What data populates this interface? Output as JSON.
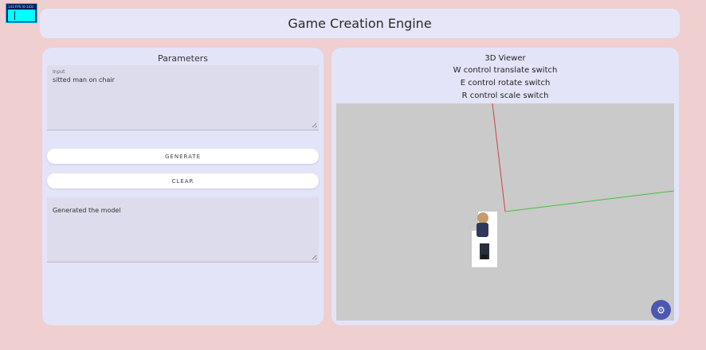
{
  "fps_overlay": {
    "label": "143 FPS (0-143)"
  },
  "header": {
    "title": "Game Creation Engine"
  },
  "parameters": {
    "title": "Parameters",
    "input_label": "Input",
    "input_value": "sitted man on chair",
    "generate_label": "GENERATE",
    "clear_label": "CLEAR",
    "output_value": "Generated the model"
  },
  "viewer": {
    "title": "3D Viewer",
    "help_w": "W control translate switch",
    "help_e": "E control rotate switch",
    "help_r": "R control scale switch",
    "settings_icon": "gear-icon"
  },
  "colors": {
    "background": "#efcfcf",
    "panel": "#e4e4f8",
    "accent": "#4b57b2",
    "axis_x": "#d24040",
    "axis_y": "#40c040"
  }
}
